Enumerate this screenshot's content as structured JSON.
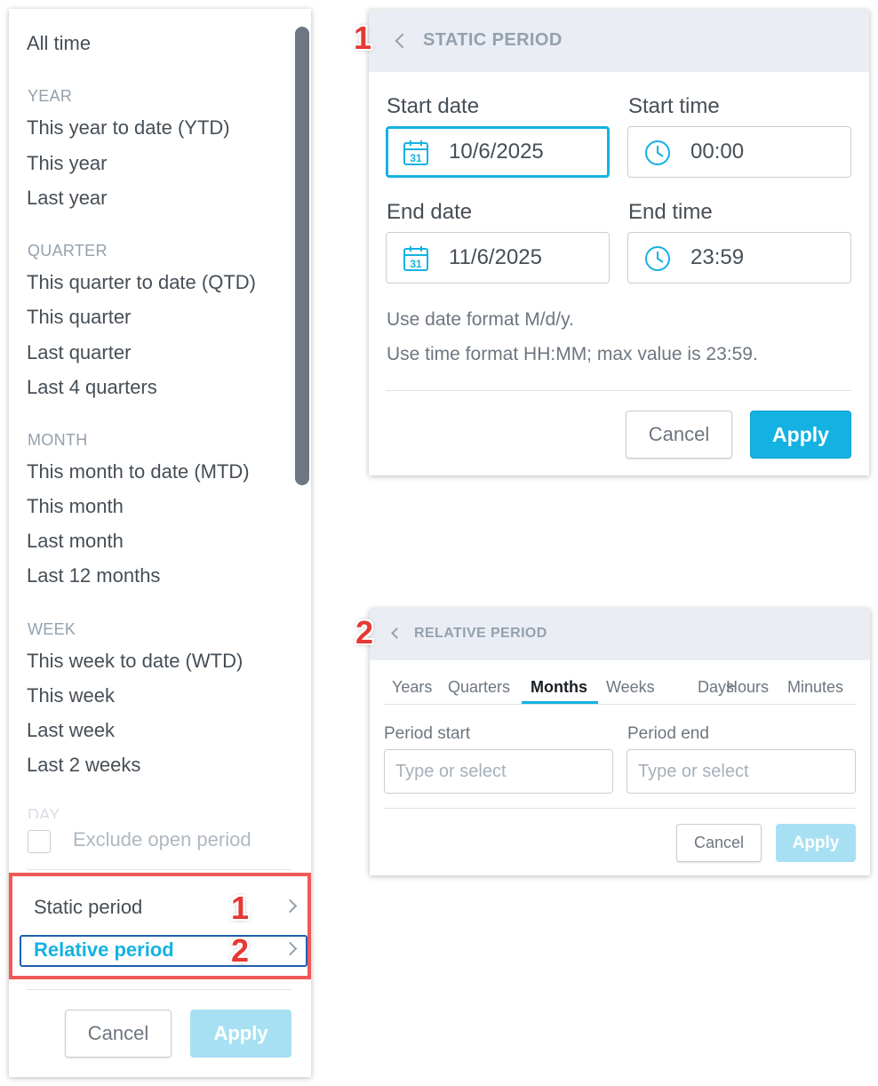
{
  "date_filter": {
    "all_time": "All time",
    "sections": [
      {
        "header": "YEAR",
        "items": [
          "This year to date (YTD)",
          "This year",
          "Last year"
        ]
      },
      {
        "header": "QUARTER",
        "items": [
          "This quarter to date (QTD)",
          "This quarter",
          "Last quarter",
          "Last 4 quarters"
        ]
      },
      {
        "header": "MONTH",
        "items": [
          "This month to date (MTD)",
          "This month",
          "Last month",
          "Last 12 months"
        ]
      },
      {
        "header": "WEEK",
        "items": [
          "This week to date (WTD)",
          "This week",
          "Last week",
          "Last 2 weeks"
        ]
      },
      {
        "header": "DAY",
        "items": []
      }
    ],
    "exclude_open_period": {
      "label": "Exclude open period",
      "checked": false
    },
    "period_options": [
      {
        "label": "Static period",
        "badge": "1",
        "active": false
      },
      {
        "label": "Relative period",
        "badge": "2",
        "active": true
      }
    ],
    "cancel_label": "Cancel",
    "apply_label": "Apply"
  },
  "static_period": {
    "badge": "1",
    "title": "STATIC PERIOD",
    "start_date_label": "Start date",
    "start_date_value": "10/6/2025",
    "start_time_label": "Start time",
    "start_time_value": "00:00",
    "end_date_label": "End date",
    "end_date_value": "11/6/2025",
    "end_time_label": "End time",
    "end_time_value": "23:59",
    "calendar_icon_text": "31",
    "hint_date": "Use date format M/d/y.",
    "hint_time": "Use time format HH:MM; max value is 23:59.",
    "cancel_label": "Cancel",
    "apply_label": "Apply"
  },
  "relative_period": {
    "badge": "2",
    "title": "RELATIVE PERIOD",
    "tabs": [
      "Years",
      "Quarters",
      "Months",
      "Weeks",
      "Days",
      "Hours",
      "Minutes"
    ],
    "active_tab": "Months",
    "period_start_label": "Period start",
    "period_start_placeholder": "Type or select",
    "period_end_label": "Period end",
    "period_end_placeholder": "Type or select",
    "cancel_label": "Cancel",
    "apply_label": "Apply"
  },
  "colors": {
    "accent": "#14b2e2",
    "badge_red": "#e53935",
    "highlight_box": "#ef5a57",
    "text": "#464e56",
    "muted": "#94a1ad"
  },
  "icons": [
    "calendar-icon",
    "clock-icon",
    "chevron-left-icon",
    "chevron-right-icon"
  ]
}
